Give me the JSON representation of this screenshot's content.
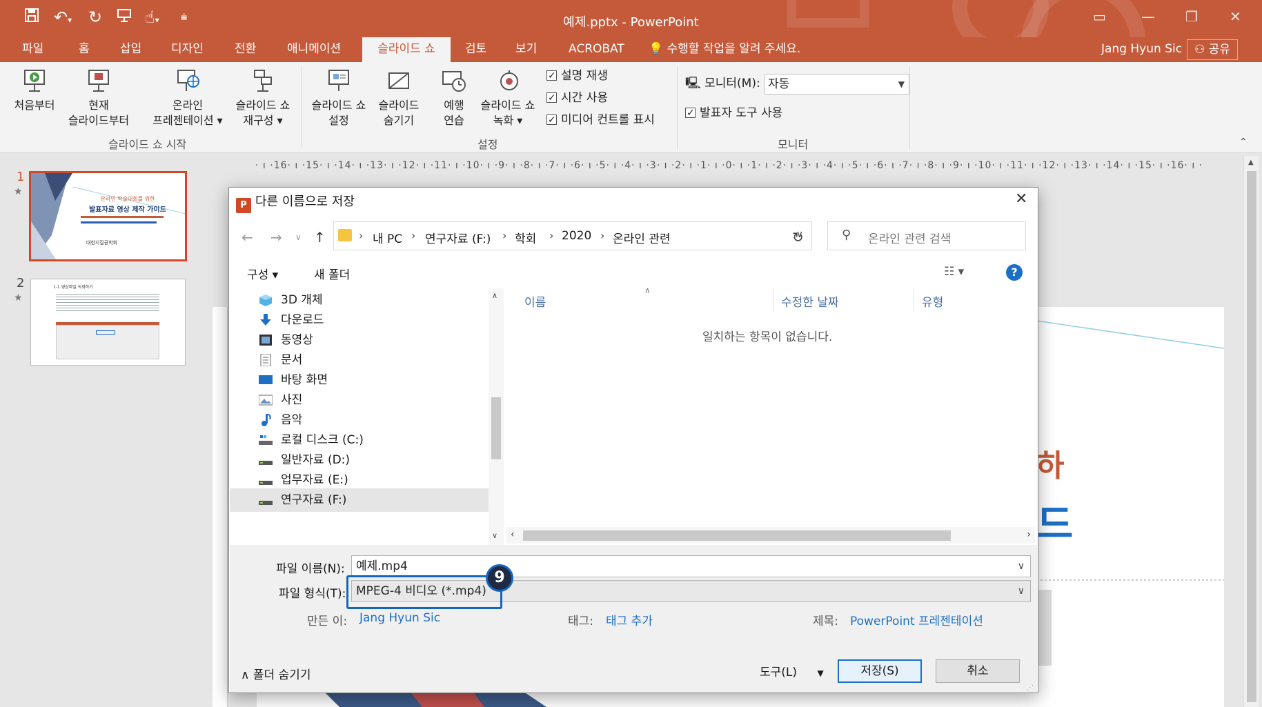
{
  "window": {
    "title": "예제.pptx  -  PowerPoint",
    "accent": "#c55a3a"
  },
  "qat": {
    "icons": [
      "save-icon",
      "undo-icon",
      "redo-icon",
      "from-beginning-icon",
      "touch-mode-icon",
      "customize-qat-icon"
    ]
  },
  "tabs": [
    {
      "label": "파일"
    },
    {
      "label": "홈"
    },
    {
      "label": "삽입"
    },
    {
      "label": "디자인"
    },
    {
      "label": "전환"
    },
    {
      "label": "애니메이션"
    },
    {
      "label": "슬라이드 쇼"
    },
    {
      "label": "검토"
    },
    {
      "label": "보기"
    },
    {
      "label": "ACROBAT"
    }
  ],
  "active_tab": "슬라이드 쇼",
  "tellme": "수행할 작업을 알려 주세요.",
  "user": {
    "name": "Jang Hyun Sic",
    "share_label": "공유"
  },
  "ribbon": {
    "start_group": {
      "label": "슬라이드 쇼 시작",
      "buttons": [
        {
          "line1": "처음부터",
          "line2": ""
        },
        {
          "line1": "현재",
          "line2": "슬라이드부터"
        },
        {
          "line1": "온라인",
          "line2": "프레젠테이션 ▾"
        },
        {
          "line1": "슬라이드 쇼",
          "line2": "재구성 ▾"
        }
      ]
    },
    "setup_group": {
      "label": "설정",
      "buttons": [
        {
          "line1": "슬라이드 쇼",
          "line2": "설정"
        },
        {
          "line1": "슬라이드",
          "line2": "숨기기"
        },
        {
          "line1": "예행",
          "line2": "연습"
        },
        {
          "line1": "슬라이드 쇼",
          "line2": "녹화 ▾"
        }
      ],
      "checkboxes": [
        "설명 재생",
        "시간 사용",
        "미디어 컨트롤 표시"
      ]
    },
    "monitor_group": {
      "label": "모니터",
      "monitor_label": "모니터(M):",
      "monitor_value": "자동",
      "presenter_view": "발표자 도구 사용"
    }
  },
  "slides": [
    {
      "number": "1",
      "title_small": "온라인 학술대회를 위한",
      "title_main": "발표자료 영상 제작 가이드",
      "society": "대한지질공학회"
    },
    {
      "number": "2",
      "heading": "1-1 영상파일 녹화하기"
    }
  ],
  "ruler_text": "· ı ·16· ı ·15· ı ·14· ı ·13· ı ·12· ı ·11· ı ·10· ı ·9· ı ·8· ı ·7· ı ·6· ı ·5· ı ·4· ı ·3· ı ·2· ı ·1· ı ·0· ı ·1· ı ·2· ı ·3· ı ·4· ı ·5· ı ·6· ı ·7· ı ·8· ı ·9· ı ·10· ı ·11· ı ·12· ı ·13· ı ·14· ı ·15· ı ·16· ı ·",
  "dialog": {
    "title": "다른 이름으로 저장",
    "breadcrumb": [
      "내 PC",
      "연구자료 (F:)",
      "학회",
      "2020",
      "온라인 관련"
    ],
    "search_placeholder": "온라인 관련 검색",
    "organize": "구성 ▾",
    "new_folder": "새 폴더",
    "nav_items": [
      {
        "label": "3D 개체",
        "icon": "3d-objects-icon"
      },
      {
        "label": "다운로드",
        "icon": "downloads-icon"
      },
      {
        "label": "동영상",
        "icon": "videos-icon"
      },
      {
        "label": "문서",
        "icon": "documents-icon"
      },
      {
        "label": "바탕 화면",
        "icon": "desktop-icon"
      },
      {
        "label": "사진",
        "icon": "pictures-icon"
      },
      {
        "label": "음악",
        "icon": "music-icon"
      },
      {
        "label": "로컬 디스크 (C:)",
        "icon": "local-disk-icon"
      },
      {
        "label": "일반자료 (D:)",
        "icon": "drive-icon"
      },
      {
        "label": "업무자료 (E:)",
        "icon": "drive-icon"
      },
      {
        "label": "연구자료 (F:)",
        "icon": "drive-icon",
        "selected": true
      }
    ],
    "columns": [
      "이름",
      "수정한 날짜",
      "유형"
    ],
    "empty_message": "일치하는 항목이 없습니다.",
    "filename_label": "파일 이름(N):",
    "filename_value": "예제.mp4",
    "filetype_label": "파일 형식(T):",
    "filetype_value": "MPEG-4 비디오 (*.mp4)",
    "authors_label": "만든 이:",
    "authors_value": "Jang Hyun Sic",
    "tags_label": "태그:",
    "tags_value": "태그 추가",
    "title_label": "제목:",
    "title_value": "PowerPoint 프레젠테이션",
    "hide_folders": "폴더 숨기기",
    "tools": "도구(L)",
    "save": "저장(S)",
    "cancel": "취소"
  },
  "annotation": {
    "step": "9",
    "color": "#1565c0"
  }
}
